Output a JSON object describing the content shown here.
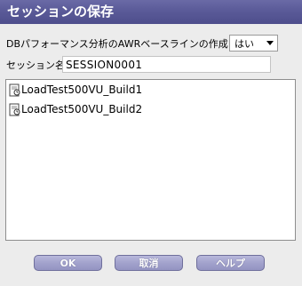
{
  "dialog": {
    "title": "セッションの保存"
  },
  "awr": {
    "label": "DBパフォーマンス分析のAWRベースラインの作成:",
    "selected": "はい"
  },
  "session": {
    "label": "セッション名:",
    "value": "SESSION0001"
  },
  "sessions_list": {
    "items": [
      {
        "label": "LoadTest500VU_Build1",
        "icon": "session-file-icon"
      },
      {
        "label": "LoadTest500VU_Build2",
        "icon": "session-file-icon"
      }
    ]
  },
  "buttons": {
    "ok": "OK",
    "cancel": "取消",
    "help": "ヘルプ"
  }
}
